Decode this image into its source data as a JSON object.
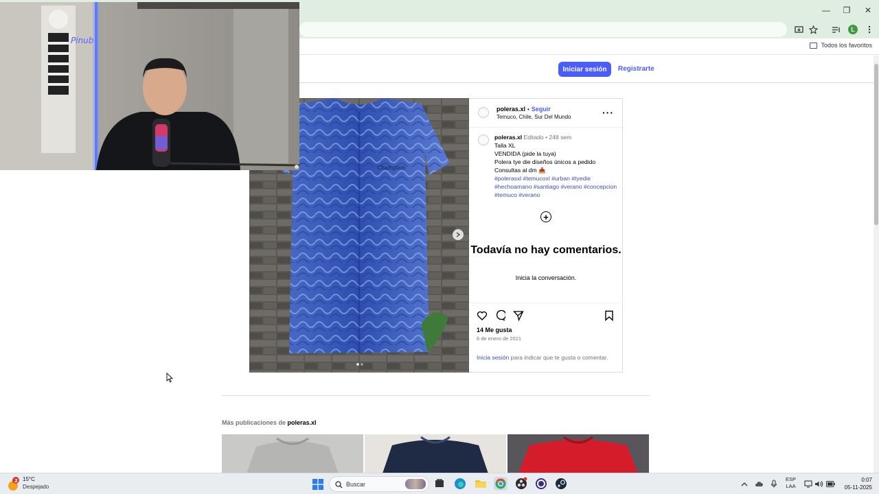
{
  "browser": {
    "window_controls": {
      "minimize": "—",
      "maximize": "❐",
      "close": "✕"
    },
    "profile_initial": "L",
    "bookmarks_all": "Todos los favoritos"
  },
  "header": {
    "login_button": "Iniciar sesión",
    "register_link": "Registrarte"
  },
  "post": {
    "username": "poleras.xl",
    "separator": "•",
    "follow": "Seguir",
    "location": "Temuco, Chile, Sur Del Mundo",
    "more": "···",
    "caption": {
      "username": "poleras.xl",
      "edited": "Editado",
      "dot": "•",
      "age": "248 sem",
      "lines": [
        "Talla XL",
        "VENDIDA (pide la tuya)",
        "Polera tye die diseños únicos a pedido",
        "Consultas al dm 📥"
      ],
      "hashtags": "#polerasxl #temucoxl #urban #tyedie #hechoamano #santiago #verano #concepcion #temuco #verano"
    },
    "shirt_logo_text": "Champion",
    "no_comments": "Todavía no hay comentarios.",
    "start_conversation": "Inicia la conversación.",
    "likes": "14 Me gusta",
    "date": "6 de enero de 2021",
    "login_hint_link": "Inicia sesión",
    "login_hint_rest": " para indicar que te gusta o comentar."
  },
  "more_posts": {
    "prefix": "Más publicaciones de ",
    "username": "poleras.xl"
  },
  "webcam": {
    "neon_sign": "Pinub"
  },
  "taskbar": {
    "weather_badge": "2",
    "temperature": "15°C",
    "condition": "Despejado",
    "search_label": "Buscar",
    "language_top": "ESP",
    "language_bottom": "LAA",
    "time": "0:07",
    "date": "05-11-2025"
  },
  "colors": {
    "brand_blue": "#4a5df9",
    "hashtag_blue": "#3d4fb0",
    "browser_chrome": "#dfeee0"
  }
}
